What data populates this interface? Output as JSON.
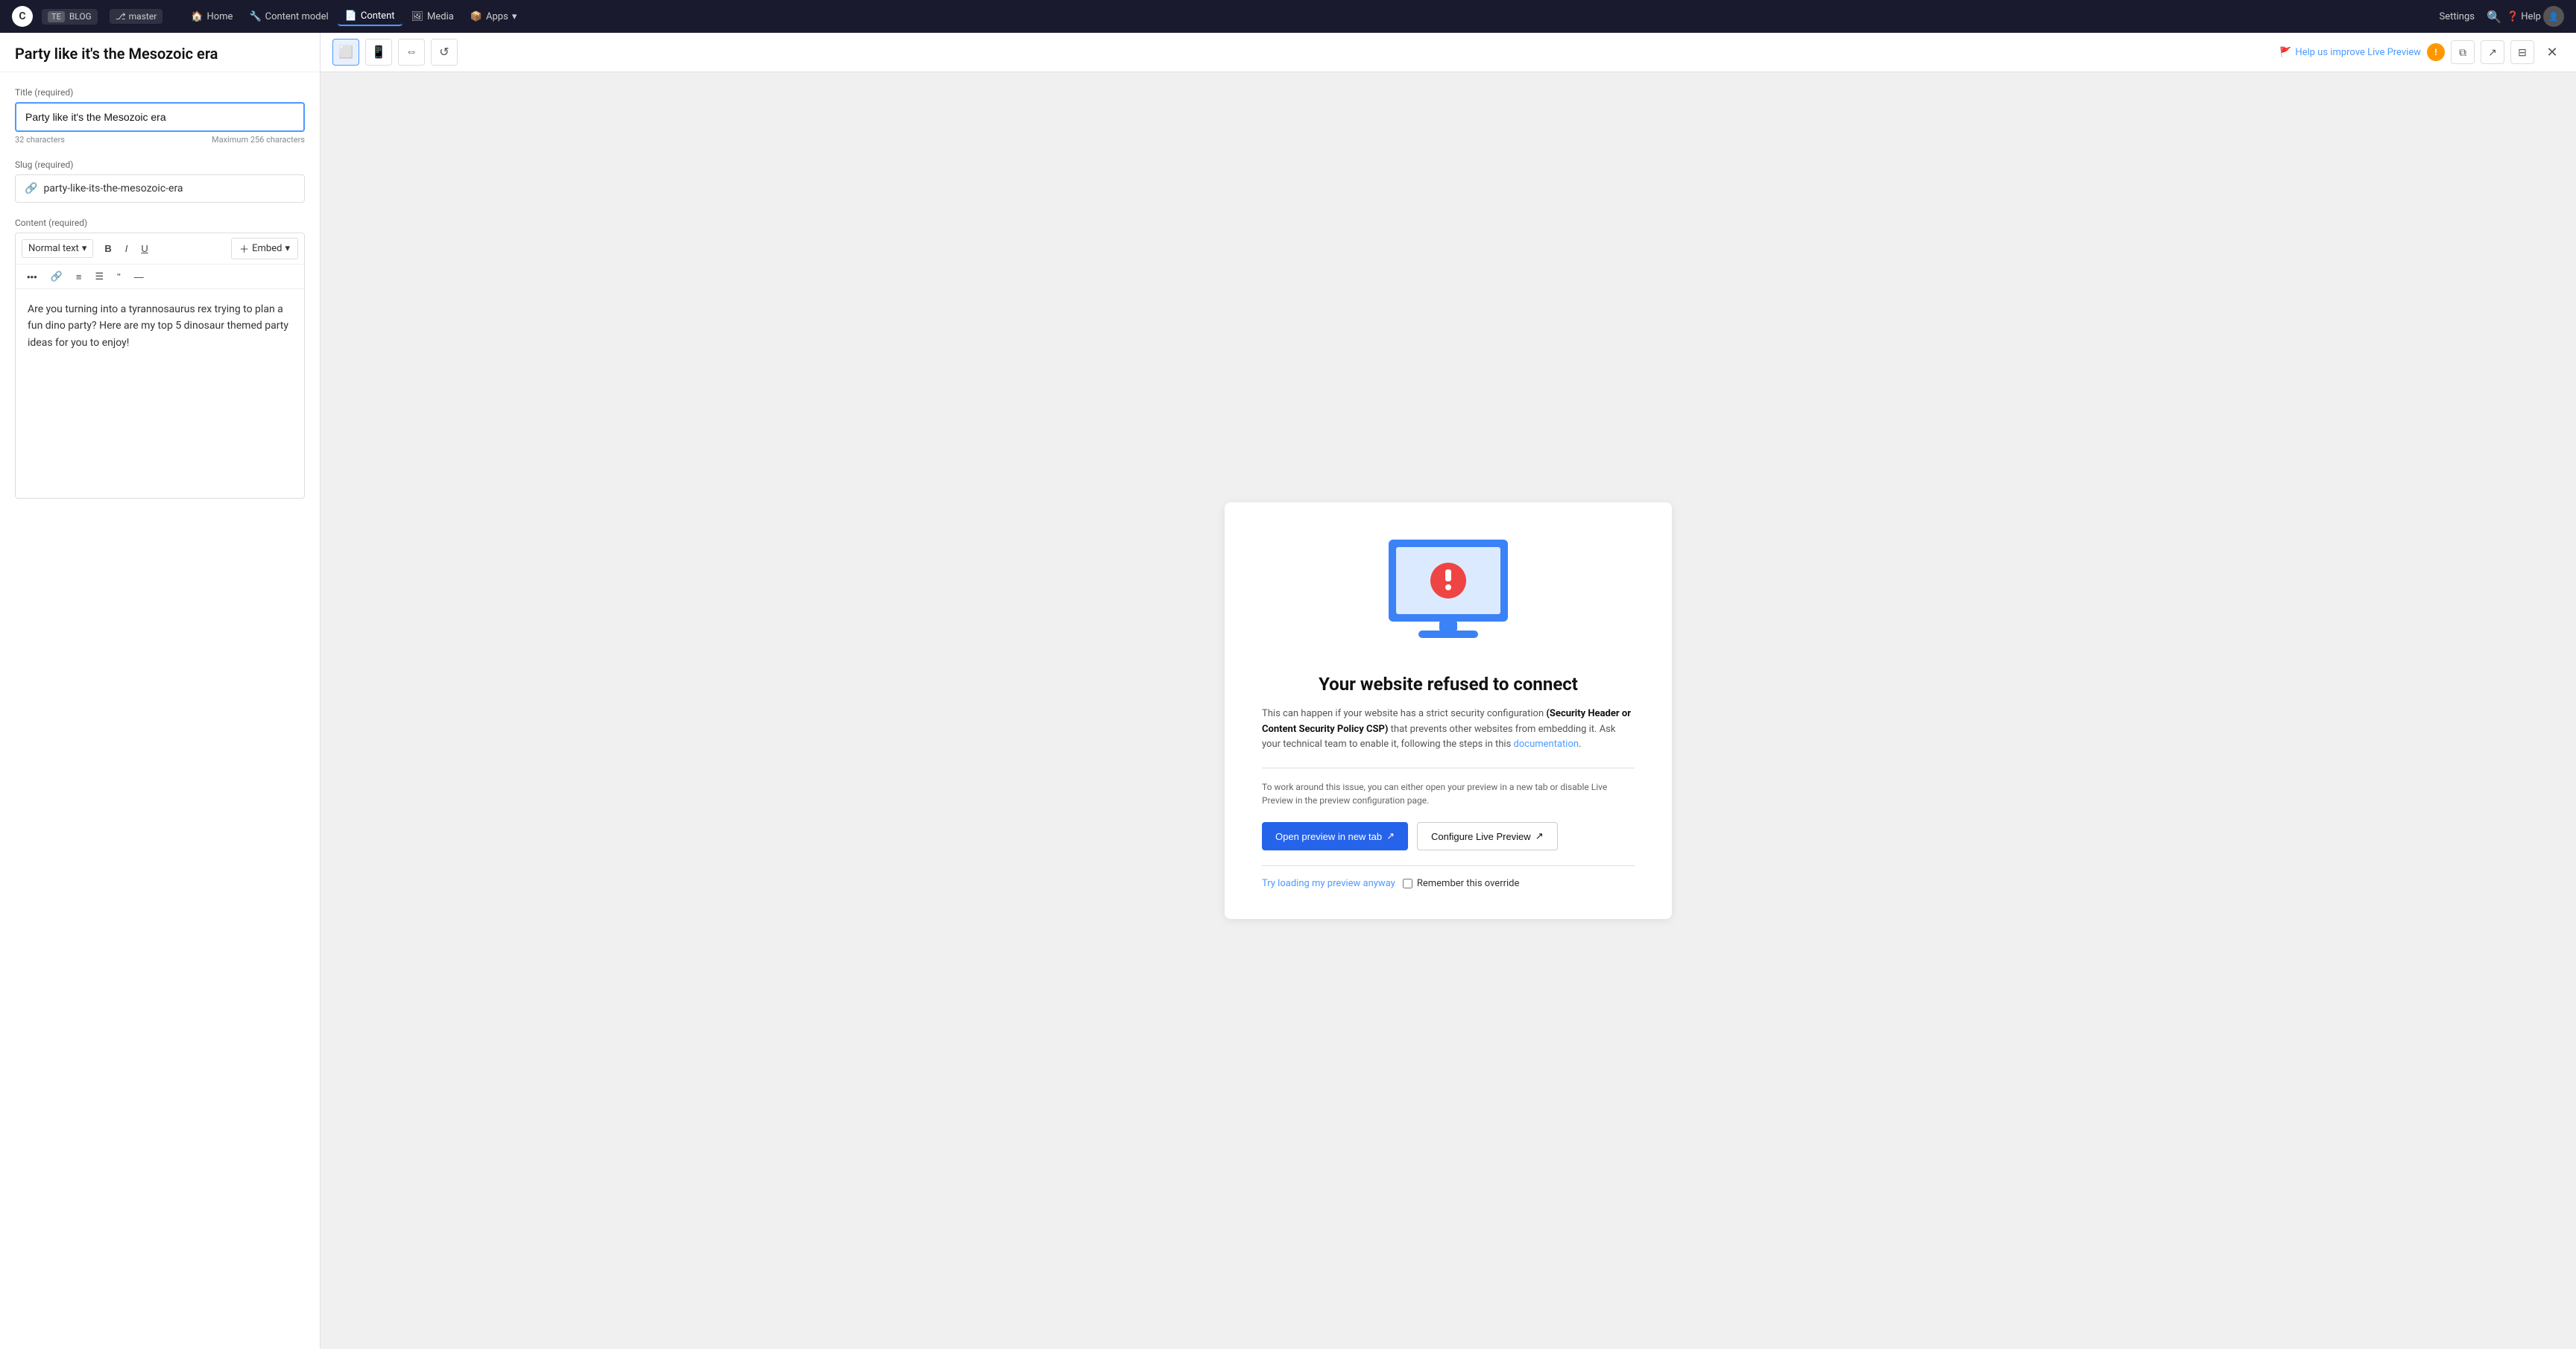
{
  "app": {
    "logo_text": "C",
    "workspace_name": "BLOG",
    "workspace_tag": "TE",
    "branch_name": "master"
  },
  "nav": {
    "links": [
      {
        "id": "home",
        "label": "Home",
        "icon": "🏠",
        "active": false
      },
      {
        "id": "content-model",
        "label": "Content model",
        "icon": "🔧",
        "active": false
      },
      {
        "id": "content",
        "label": "Content",
        "icon": "📄",
        "active": true
      },
      {
        "id": "media",
        "label": "Media",
        "icon": "🖼",
        "active": false
      },
      {
        "id": "apps",
        "label": "Apps",
        "icon": "📦",
        "active": false,
        "has_dropdown": true
      }
    ],
    "settings_label": "Settings",
    "help_label": "Help"
  },
  "page_title": "Party like it's the Mesozoic era",
  "form": {
    "title_field": {
      "label": "Title (required)",
      "value": "Party like it's the Mesozoic era",
      "char_count": "32 characters",
      "max_chars": "Maximum 256 characters"
    },
    "slug_field": {
      "label": "Slug (required)",
      "value": "party-like-its-the-mesozoic-era"
    },
    "content_field": {
      "label": "Content (required)",
      "text_style": "Normal text",
      "embed_label": "Embed",
      "body": "Are you turning into a tyrannosaurus rex trying to plan a fun dino party? Here are my top 5 dinosaur themed party ideas for you to enjoy!"
    }
  },
  "preview": {
    "toolbar": {
      "help_link": "Help us improve Live Preview",
      "desktop_icon": "desktop",
      "mobile_icon": "mobile",
      "split_icon": "split",
      "refresh_icon": "refresh"
    },
    "error": {
      "title": "Your website refused to connect",
      "desc_part1": "This can happen if your website has a strict security configuration ",
      "desc_bold": "(Security Header or Content Security Policy CSP)",
      "desc_part2": " that prevents other websites from embedding it. Ask your technical team to enable it, following the steps in this ",
      "desc_link": "documentation",
      "desc_link_suffix": ".",
      "workaround": "To work around this issue, you can either open your preview in a new tab or disable Live Preview in the preview configuration page.",
      "btn_open_new_tab": "Open preview in new tab",
      "btn_configure": "Configure Live Preview",
      "try_link": "Try loading my preview anyway",
      "remember_label": "Remember this override"
    }
  },
  "toolbar_buttons": {
    "bold": "B",
    "italic": "I",
    "underline": "U",
    "more": "•••",
    "link": "🔗",
    "bullet": "≡",
    "numbered": "≡",
    "quote": "❝",
    "divider": "—"
  }
}
